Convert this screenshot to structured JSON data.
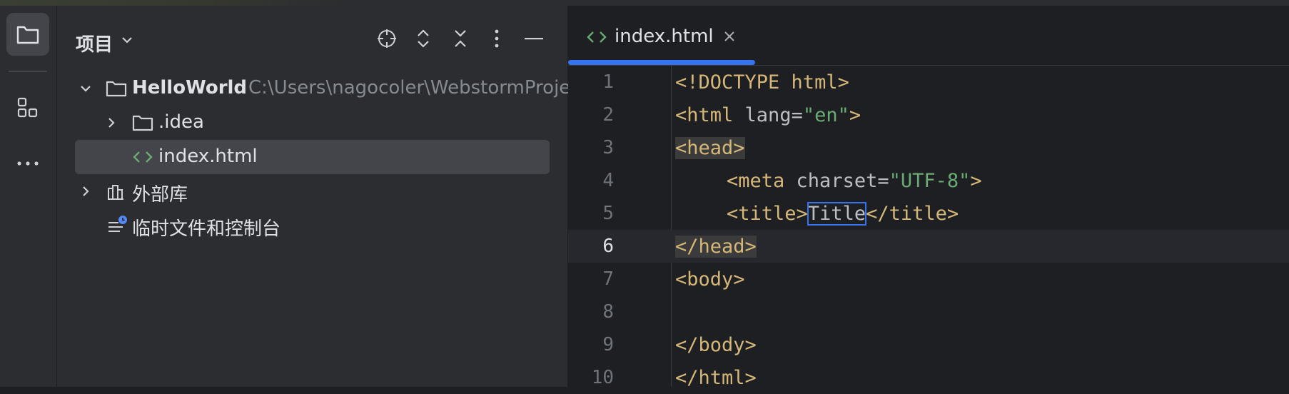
{
  "activity_bar": {
    "items": [
      {
        "icon": "folder-icon",
        "active": true
      },
      {
        "icon": "structure-icon",
        "active": false
      },
      {
        "icon": "more-icon",
        "active": false
      }
    ]
  },
  "project_panel": {
    "title": "项目",
    "tree": [
      {
        "label": "HelloWorld",
        "path": "C:\\Users\\nagocoler\\WebstormProje",
        "type": "folder",
        "expanded": true
      },
      {
        "label": ".idea",
        "type": "folder",
        "expanded": false
      },
      {
        "label": "index.html",
        "type": "html-file",
        "selected": true
      },
      {
        "label": "外部库",
        "type": "library",
        "expanded": false
      },
      {
        "label": "临时文件和控制台",
        "type": "scratches"
      }
    ]
  },
  "editor": {
    "tab": {
      "label": "index.html"
    },
    "line_numbers": [
      "1",
      "2",
      "3",
      "4",
      "5",
      "6",
      "7",
      "8",
      "9",
      "10"
    ],
    "current_line": "6",
    "lines": {
      "l1": "<!DOCTYPE html>",
      "l2_open": "<html ",
      "l2_attr": "lang",
      "l2_eq": "=",
      "l2_str": "\"en\"",
      "l2_close": ">",
      "l3": "<head>",
      "l4_open": "<meta ",
      "l4_attr": "charset",
      "l4_eq": "=",
      "l4_str": "\"UTF-8\"",
      "l4_close": ">",
      "l5_open": "<title>",
      "l5_text": "Title",
      "l5_close": "</title>",
      "l6": "</head>",
      "l7": "<body>",
      "l9": "</body>",
      "l10": "</html>"
    }
  },
  "colors": {
    "accent": "#3574f0",
    "tag": "#d5b778",
    "string": "#6aab73",
    "html_icon": "#6aab73"
  }
}
